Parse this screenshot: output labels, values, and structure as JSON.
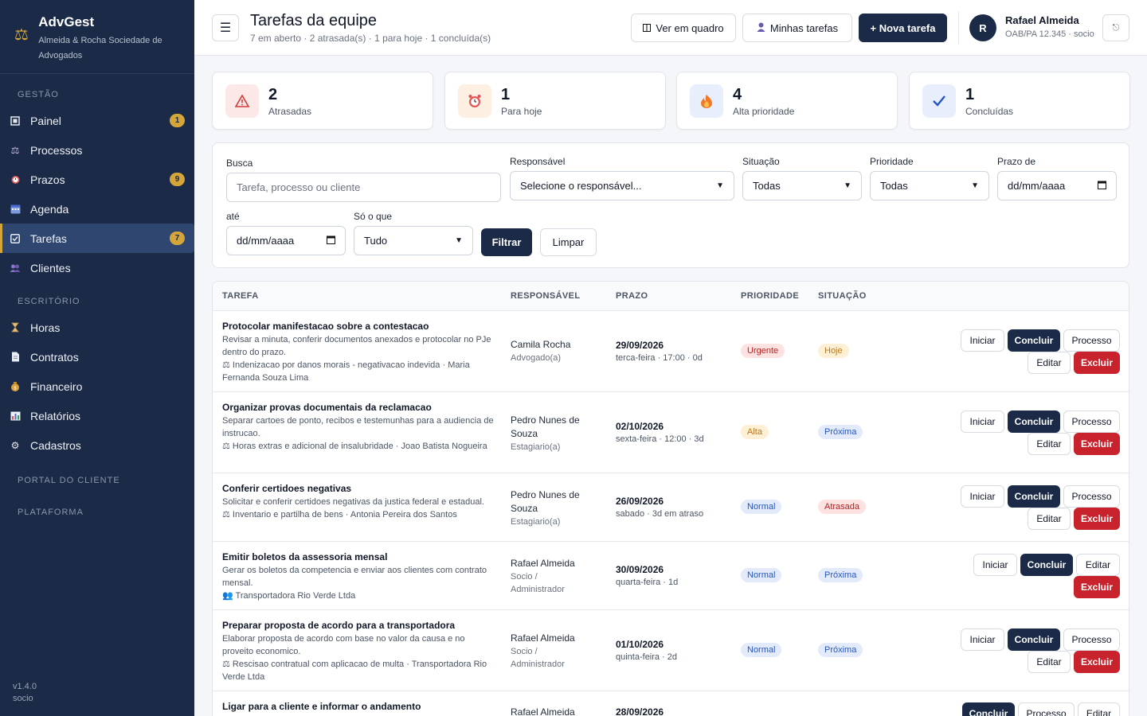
{
  "brand": {
    "name": "AdvGest",
    "firm": "Almeida & Rocha Sociedade de Advogados"
  },
  "sidebar": {
    "sections": [
      "Gestão",
      "Escritório",
      "Portal do cliente",
      "Plataforma"
    ],
    "items": [
      {
        "label": "Painel",
        "badge": "1",
        "icon": "dashboard-icon"
      },
      {
        "label": "Processos",
        "badge": "",
        "icon": "scales-icon"
      },
      {
        "label": "Prazos",
        "badge": "9",
        "icon": "alarm-clock-icon"
      },
      {
        "label": "Agenda",
        "badge": "",
        "icon": "calendar-icon"
      },
      {
        "label": "Tarefas",
        "badge": "7",
        "icon": "checkbox-icon",
        "active": true
      },
      {
        "label": "Clientes",
        "badge": "",
        "icon": "people-icon"
      },
      {
        "label": "Horas",
        "badge": "",
        "icon": "hourglass-icon"
      },
      {
        "label": "Contratos",
        "badge": "",
        "icon": "document-icon"
      },
      {
        "label": "Financeiro",
        "badge": "",
        "icon": "money-bag-icon"
      },
      {
        "label": "Relatórios",
        "badge": "",
        "icon": "bar-chart-icon"
      },
      {
        "label": "Cadastros",
        "badge": "",
        "icon": "gear-icon"
      }
    ],
    "version": "v1.4.0",
    "role": "socio"
  },
  "header": {
    "title": "Tarefas da equipe",
    "subtitle": "7 em aberto · 2 atrasada(s) · 1 para hoje · 1 concluída(s)",
    "board_label": "Ver em quadro",
    "my_tasks_label": "Minhas tarefas",
    "new_task_label": "+ Nova tarefa"
  },
  "user": {
    "initial": "R",
    "name": "Rafael Almeida",
    "info": "OAB/PA 12.345 · socio"
  },
  "stats": [
    {
      "value": "2",
      "label": "Atrasadas",
      "icon": "warning-icon",
      "bg": "#fde8e8"
    },
    {
      "value": "1",
      "label": "Para hoje",
      "icon": "alarm-clock-icon",
      "bg": "#fdf0e3"
    },
    {
      "value": "4",
      "label": "Alta prioridade",
      "icon": "fire-icon",
      "bg": "#e8eefb"
    },
    {
      "value": "1",
      "label": "Concluídas",
      "icon": "check-icon",
      "bg": "#e8eefb"
    }
  ],
  "filters": {
    "search_label": "Busca",
    "search_placeholder": "Tarefa, processo ou cliente",
    "responsible_label": "Responsável",
    "responsible_value": "Selecione o responsável...",
    "status_label": "Situação",
    "status_value": "Todas",
    "priority_label": "Prioridade",
    "priority_value": "Todas",
    "from_label": "Prazo de",
    "from_value": "dd/mm/aaaa",
    "to_label": "até",
    "to_value": "dd/mm/aaaa",
    "only_label": "Só o que",
    "only_value": "Tudo",
    "filter_button": "Filtrar",
    "clear_button": "Limpar"
  },
  "table": {
    "headers": [
      "TAREFA",
      "RESPONSÁVEL",
      "PRAZO",
      "PRIORIDADE",
      "SITUAÇÃO"
    ],
    "rows": [
      {
        "title": "Protocolar manifestacao sobre a contestacao",
        "desc": "Revisar a minuta, conferir documentos anexados e protocolar no PJe dentro do prazo.",
        "ref": "⚖ Indenizacao por danos morais - negativacao indevida · Maria Fernanda Souza Lima",
        "resp": "Camila Rocha",
        "resp_role": "Advogado(a)",
        "date": "29/09/2026",
        "date_sub": "terca-feira · 17:00 · 0d",
        "priority": "Urgente",
        "status": "Hoje",
        "actions": [
          "Iniciar",
          "Concluir",
          "Processo",
          "Editar",
          "Excluir"
        ]
      },
      {
        "title": "Organizar provas documentais da reclamacao",
        "desc": "Separar cartoes de ponto, recibos e testemunhas para a audiencia de instrucao.",
        "ref": "⚖ Horas extras e adicional de insalubridade · Joao Batista Nogueira",
        "resp": "Pedro Nunes de Souza",
        "resp_role": "Estagiario(a)",
        "date": "02/10/2026",
        "date_sub": "sexta-feira · 12:00 · 3d",
        "priority": "Alta",
        "status": "Próxima",
        "actions": [
          "Iniciar",
          "Concluir",
          "Processo",
          "Editar",
          "Excluir"
        ]
      },
      {
        "title": "Conferir certidoes negativas",
        "desc": "Solicitar e conferir certidoes negativas da justica federal e estadual.",
        "ref": "⚖ Inventario e partilha de bens · Antonia Pereira dos Santos",
        "resp": "Pedro Nunes de Souza",
        "resp_role": "Estagiario(a)",
        "date": "26/09/2026",
        "date_sub": "sabado · 3d em atraso",
        "priority": "Normal",
        "status": "Atrasada",
        "actions": [
          "Iniciar",
          "Concluir",
          "Processo",
          "Editar",
          "Excluir"
        ]
      },
      {
        "title": "Emitir boletos da assessoria mensal",
        "desc": "Gerar os boletos da competencia e enviar aos clientes com contrato mensal.",
        "ref": "👥 Transportadora Rio Verde Ltda",
        "resp": "Rafael Almeida",
        "resp_role": "Socio / Administrador",
        "date": "30/09/2026",
        "date_sub": "quarta-feira · 1d",
        "priority": "Normal",
        "status": "Próxima",
        "actions": [
          "Iniciar",
          "Concluir",
          "Editar",
          "Excluir"
        ]
      },
      {
        "title": "Preparar proposta de acordo para a transportadora",
        "desc": "Elaborar proposta de acordo com base no valor da causa e no proveito economico.",
        "ref": "⚖ Rescisao contratual com aplicacao de multa · Transportadora Rio Verde Ltda",
        "resp": "Rafael Almeida",
        "resp_role": "Socio / Administrador",
        "date": "01/10/2026",
        "date_sub": "quinta-feira · 2d",
        "priority": "Normal",
        "status": "Próxima",
        "actions": [
          "Iniciar",
          "Concluir",
          "Processo",
          "Editar",
          "Excluir"
        ]
      },
      {
        "title": "Ligar para a cliente e informar o andamento",
        "desc": "",
        "ref": "",
        "resp": "Rafael Almeida",
        "resp_role": "",
        "date": "28/09/2026",
        "date_sub": "",
        "priority": "",
        "status": "",
        "actions": [
          "Concluir",
          "Processo",
          "Editar"
        ]
      }
    ]
  },
  "colors": {
    "sidebar_bg": "#1b2a47",
    "accent": "#d4a63a",
    "primary": "#1b2a47",
    "danger": "#c8232c",
    "urgente_bg": "#fde2e2",
    "urgente_fg": "#b42323",
    "alta_bg": "#fdf0d5",
    "alta_fg": "#b7791f",
    "normal_bg": "#e3ebfb",
    "normal_fg": "#2356c2",
    "hoje_bg": "#fdf0d5",
    "hoje_fg": "#b7791f",
    "proxima_bg": "#e3ebfb",
    "proxima_fg": "#2356c2",
    "atrasada_bg": "#fde2e2",
    "atrasada_fg": "#b42323"
  }
}
